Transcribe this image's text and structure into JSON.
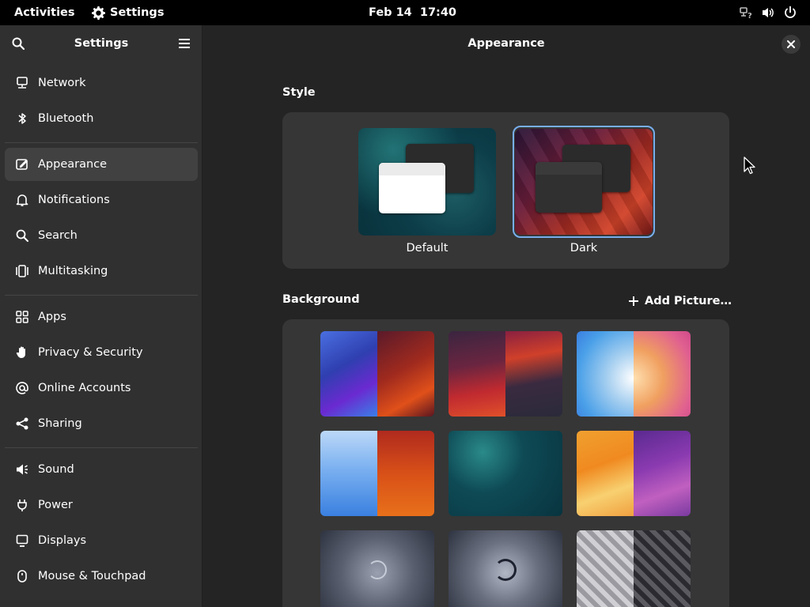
{
  "topbar": {
    "activities": "Activities",
    "app_name": "Settings",
    "clock": "Feb 14  17:40",
    "icons": [
      "network-question-icon",
      "volume-icon",
      "power-icon"
    ]
  },
  "sidebar": {
    "title": "Settings",
    "items": [
      {
        "label": "Network",
        "icon": "network-icon"
      },
      {
        "label": "Bluetooth",
        "icon": "bluetooth-icon"
      },
      {
        "label": "Appearance",
        "icon": "appearance-icon",
        "active": true
      },
      {
        "label": "Notifications",
        "icon": "bell-icon"
      },
      {
        "label": "Search",
        "icon": "search-icon"
      },
      {
        "label": "Multitasking",
        "icon": "multitasking-icon"
      },
      {
        "label": "Apps",
        "icon": "apps-grid-icon"
      },
      {
        "label": "Privacy & Security",
        "icon": "hand-icon"
      },
      {
        "label": "Online Accounts",
        "icon": "at-sign-icon"
      },
      {
        "label": "Sharing",
        "icon": "share-icon"
      },
      {
        "label": "Sound",
        "icon": "speaker-icon"
      },
      {
        "label": "Power",
        "icon": "power-plug-icon"
      },
      {
        "label": "Displays",
        "icon": "display-icon"
      },
      {
        "label": "Mouse & Touchpad",
        "icon": "mouse-icon"
      }
    ]
  },
  "main": {
    "title": "Appearance",
    "style_section": {
      "title": "Style",
      "options": [
        {
          "label": "Default",
          "selected": false
        },
        {
          "label": "Dark",
          "selected": true
        }
      ]
    },
    "background_section": {
      "title": "Background",
      "add_picture": "Add Picture…"
    }
  },
  "colors": {
    "accent": "#3584e4",
    "sidebar_bg": "#303030",
    "main_bg": "#242424",
    "card_bg": "#363636"
  }
}
